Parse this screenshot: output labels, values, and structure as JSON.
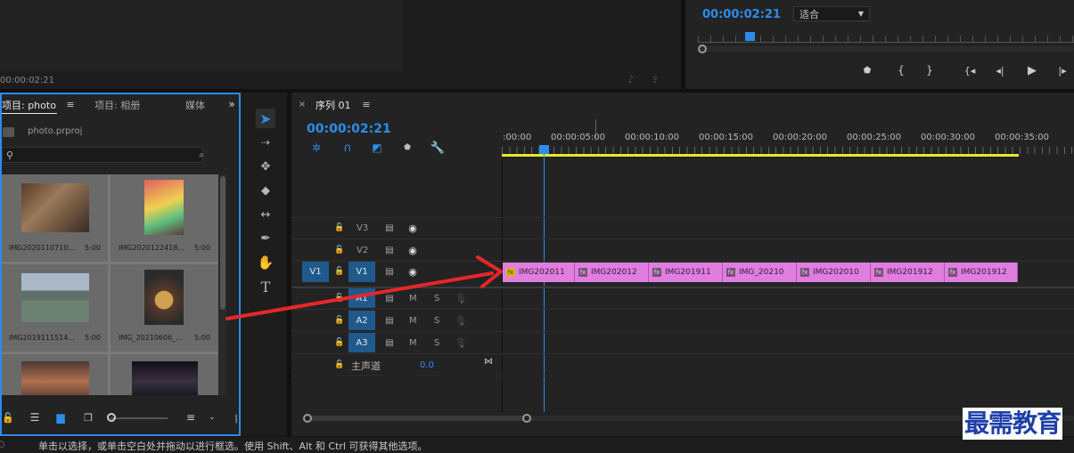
{
  "source_monitor": {
    "timecode": "00:00:02:21"
  },
  "program_monitor": {
    "timecode": "00:00:02:21",
    "fit_option": "适合"
  },
  "project_panel": {
    "tabs": [
      "项目: photo",
      "项目: 相册",
      "媒体"
    ],
    "file_name": "photo.prproj",
    "search_placeholder": "",
    "items": [
      {
        "name": "IMG2020110710...",
        "duration": "5:00"
      },
      {
        "name": "IMG2020122418...",
        "duration": "5:00"
      },
      {
        "name": "IMG2019111514...",
        "duration": "5:00"
      },
      {
        "name": "IMG_20210606_...",
        "duration": "5:00"
      },
      {
        "name": "",
        "duration": ""
      },
      {
        "name": "",
        "duration": ""
      }
    ]
  },
  "sequence": {
    "tab_label": "序列 01",
    "timecode": "00:00:02:21",
    "ruler_ticks": [
      ":00:00",
      "00:00:05:00",
      "00:00:10:00",
      "00:00:15:00",
      "00:00:20:00",
      "00:00:25:00",
      "00:00:30:00",
      "00:00:35:00"
    ],
    "video_tracks": [
      "V3",
      "V2",
      "V1"
    ],
    "source_patch": "V1",
    "audio_tracks": [
      "A1",
      "A2",
      "A3"
    ],
    "mute_label": "M",
    "solo_label": "S",
    "master_label": "主声道",
    "master_value": "0.0",
    "clips": [
      "IMG202011",
      "IMG202012",
      "IMG201911",
      "IMG_20210",
      "IMG202010",
      "IMG201912",
      "IMG201912"
    ]
  },
  "status_bar": {
    "text": "单击以选择，或单击空白处并拖动以进行框选。使用 Shift、Alt 和 Ctrl 可获得其他选项。"
  },
  "watermark": "最需教育",
  "colors": {
    "accent_blue": "#2d8ceb",
    "clip_pink": "#e07ee0",
    "work_area_yellow": "#e6e62e",
    "annotation_red": "#e8262b"
  }
}
